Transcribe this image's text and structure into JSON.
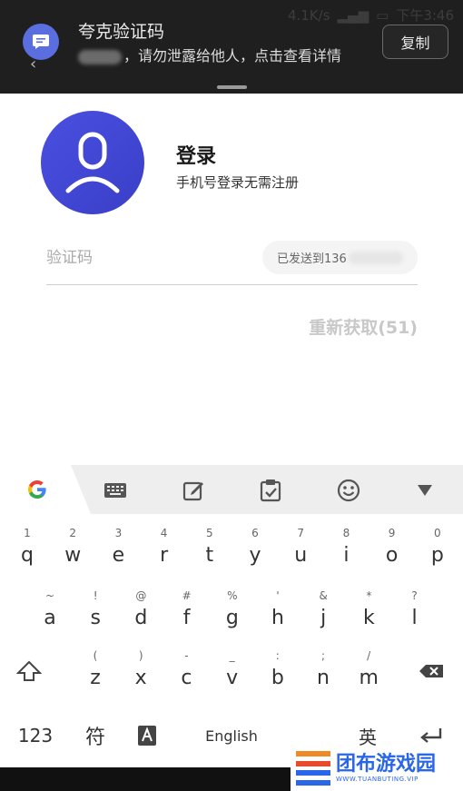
{
  "status_bar": {
    "speed": "4.1K/s",
    "time": "下午3:46"
  },
  "notification": {
    "app": "夸克验证码",
    "body": "，请勿泄露给他人，点击查看详情",
    "copy_label": "复制"
  },
  "login": {
    "title": "登录",
    "subtitle": "手机号登录无需注册",
    "code_placeholder": "验证码",
    "sent_to": "已发送到136",
    "resend": "重新获取(51)"
  },
  "keyboard": {
    "row1": [
      {
        "num": "1",
        "key": "q"
      },
      {
        "num": "2",
        "key": "w"
      },
      {
        "num": "3",
        "key": "e"
      },
      {
        "num": "4",
        "key": "r"
      },
      {
        "num": "5",
        "key": "t"
      },
      {
        "num": "6",
        "key": "y"
      },
      {
        "num": "7",
        "key": "u"
      },
      {
        "num": "8",
        "key": "i"
      },
      {
        "num": "9",
        "key": "o"
      },
      {
        "num": "0",
        "key": "p"
      }
    ],
    "row2": [
      {
        "sym": "~",
        "key": "a"
      },
      {
        "sym": "!",
        "key": "s"
      },
      {
        "sym": "@",
        "key": "d"
      },
      {
        "sym": "#",
        "key": "f"
      },
      {
        "sym": "%",
        "key": "g"
      },
      {
        "sym": "'",
        "key": "h"
      },
      {
        "sym": "&",
        "key": "j"
      },
      {
        "sym": "*",
        "key": "k"
      },
      {
        "sym": "?",
        "key": "l"
      }
    ],
    "row3": [
      {
        "sym": "(",
        "key": "z"
      },
      {
        "sym": ")",
        "key": "x"
      },
      {
        "sym": "-",
        "key": "c"
      },
      {
        "sym": "_",
        "key": "v"
      },
      {
        "sym": ":",
        "key": "b"
      },
      {
        "sym": ";",
        "key": "n"
      },
      {
        "sym": "/",
        "key": "m"
      }
    ],
    "num_label": "123",
    "symbol_label": "符",
    "space_label": "English",
    "lang_label": "英"
  },
  "watermark": {
    "cn": "团布游戏园",
    "en": "WWW.TUANBUTING.VIP"
  },
  "colors": {
    "accent": "#3f45d6",
    "notif_bg": "#1f1f1f",
    "toolbar_bg": "#eeeeee"
  }
}
